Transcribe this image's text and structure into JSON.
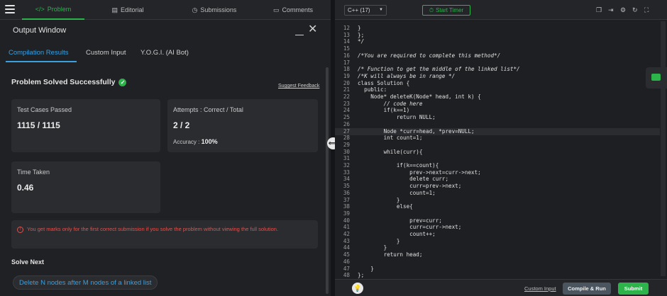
{
  "nav": {
    "menu_icon": "hamburger-icon",
    "tabs": [
      {
        "label": "Problem",
        "icon": "code-icon"
      },
      {
        "label": "Editorial",
        "icon": "document-icon"
      },
      {
        "label": "Submissions",
        "icon": "clock-icon"
      },
      {
        "label": "Comments",
        "icon": "comment-icon"
      }
    ]
  },
  "output": {
    "title": "Output Window",
    "tabs": [
      "Compilation Results",
      "Custom Input",
      "Y.O.G.I. (AI Bot)"
    ],
    "status": "Problem Solved Successfully",
    "feedback_link": "Suggest Feedback",
    "test_cases_label": "Test Cases Passed",
    "test_cases_value": "1115 / 1115",
    "attempts_label": "Attempts : Correct / Total",
    "attempts_value": "2 / 2",
    "accuracy_label": "Accuracy :",
    "accuracy_value": "100%",
    "time_label": "Time Taken",
    "time_value": "0.46",
    "warning": "You get marks only for the first correct submission if you solve the problem without viewing the full solution.",
    "solve_next_heading": "Solve Next",
    "solve_next_link": "Delete N nodes after M nodes of a linked list"
  },
  "editor": {
    "language": "C++ (17)",
    "timer_label": "Start Timer",
    "lines": [
      {
        "n": "12",
        "t": "}"
      },
      {
        "n": "13",
        "t": "};"
      },
      {
        "n": "14",
        "t": "*/"
      },
      {
        "n": "15",
        "t": ""
      },
      {
        "n": "16",
        "t": "/*You are required to complete this method*/"
      },
      {
        "n": "17",
        "t": ""
      },
      {
        "n": "18",
        "t": "/* Function to get the middle of the linked list*/"
      },
      {
        "n": "19",
        "t": "/*K will always be in range */"
      },
      {
        "n": "20",
        "t": "class Solution {"
      },
      {
        "n": "21",
        "t": "  public:"
      },
      {
        "n": "22",
        "t": "    Node* deleteK(Node* head, int k) {"
      },
      {
        "n": "23",
        "t": "        // code here"
      },
      {
        "n": "24",
        "t": "        if(k==1)"
      },
      {
        "n": "25",
        "t": "            return NULL;"
      },
      {
        "n": "26",
        "t": ""
      },
      {
        "n": "27",
        "t": "        Node *curr=head, *prev=NULL;"
      },
      {
        "n": "28",
        "t": "        int count=1;"
      },
      {
        "n": "29",
        "t": ""
      },
      {
        "n": "30",
        "t": "        while(curr){"
      },
      {
        "n": "31",
        "t": ""
      },
      {
        "n": "32",
        "t": "            if(k==count){"
      },
      {
        "n": "33",
        "t": "                prev->next=curr->next;"
      },
      {
        "n": "34",
        "t": "                delete curr;"
      },
      {
        "n": "35",
        "t": "                curr=prev->next;"
      },
      {
        "n": "36",
        "t": "                count=1;"
      },
      {
        "n": "37",
        "t": "            }"
      },
      {
        "n": "38",
        "t": "            else{"
      },
      {
        "n": "39",
        "t": ""
      },
      {
        "n": "40",
        "t": "                prev=curr;"
      },
      {
        "n": "41",
        "t": "                curr=curr->next;"
      },
      {
        "n": "42",
        "t": "                count++;"
      },
      {
        "n": "43",
        "t": "            }"
      },
      {
        "n": "44",
        "t": "        }"
      },
      {
        "n": "45",
        "t": "        return head;"
      },
      {
        "n": "46",
        "t": ""
      },
      {
        "n": "47",
        "t": "    }"
      },
      {
        "n": "48",
        "t": "};"
      }
    ]
  },
  "footer": {
    "custom_input": "Custom Input",
    "compile_run": "Compile & Run",
    "submit": "Submit"
  },
  "colors": {
    "accent_green": "#2cb34a",
    "accent_blue": "#3aa0e0",
    "warning_red": "#e0534f"
  }
}
